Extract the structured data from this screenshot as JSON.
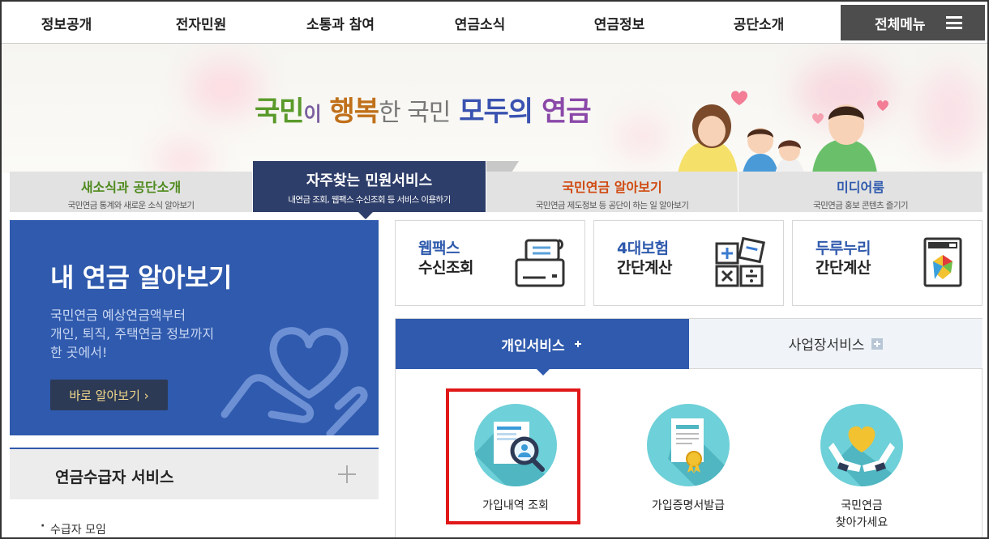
{
  "nav": {
    "items": [
      "정보공개",
      "전자민원",
      "소통과 참여",
      "연금소식",
      "연금정보",
      "공단소개"
    ],
    "all_menu": "전체메뉴"
  },
  "banner": {
    "slogan_part1": "국민",
    "slogan_part2": "이",
    "slogan_part3": "행복",
    "slogan_part4": "한 국민",
    "slogan_part5": "모두의",
    "slogan_part6": "연금"
  },
  "tabs": [
    {
      "title": "새소식과 공단소개",
      "sub": "국민연금 통계와 새로운 소식 알아보기",
      "color": "#4f8a1e"
    },
    {
      "title": "자주찾는 민원서비스",
      "sub": "내연금 조회, 웹팩스 수신조회 등 서비스 이용하기",
      "color": "#ffffff"
    },
    {
      "title": "국민연금 알아보기",
      "sub": "국민연금 제도정보 등 공단이 하는 일 알아보기",
      "color": "#d04a10"
    },
    {
      "title": "미디어룸",
      "sub": "국민연금 홍보 콘텐츠 즐기기",
      "color": "#2f5aad"
    }
  ],
  "my_pension": {
    "title": "내 연금 알아보기",
    "desc": "국민연금 예상연금액부터\n개인, 퇴직, 주택연금 정보까지\n한 곳에서!",
    "button": "바로 알아보기 ›"
  },
  "recipient": {
    "title": "연금수급자 서비스",
    "first_item": "수급자 모임"
  },
  "quick": [
    {
      "line1": "웹팩스",
      "line2": "수신조회"
    },
    {
      "line1": "4대보험",
      "line2": "간단계산"
    },
    {
      "line1": "두루누리",
      "line2": "간단계산"
    }
  ],
  "service_tabs": {
    "personal": "개인서비스",
    "business": "사업장서비스"
  },
  "services": [
    {
      "label": "가입내역 조회"
    },
    {
      "label": "가입증명서발급"
    },
    {
      "label": "국민연금\n찾아가세요"
    }
  ]
}
